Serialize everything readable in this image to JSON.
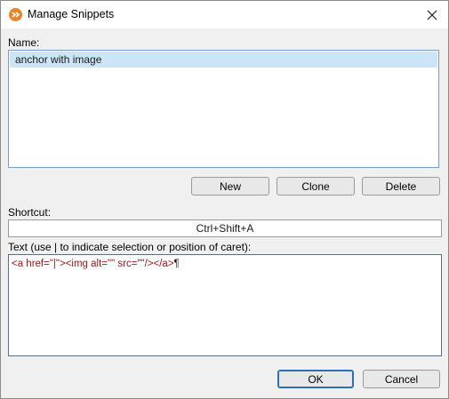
{
  "window": {
    "title": "Manage Snippets",
    "icon": "app-logo-icon",
    "close_icon": "close-icon"
  },
  "name_section": {
    "label": "Name:",
    "items": [
      {
        "label": "anchor with image",
        "selected": true
      }
    ]
  },
  "list_buttons": {
    "new_label": "New",
    "clone_label": "Clone",
    "delete_label": "Delete"
  },
  "shortcut_section": {
    "label": "Shortcut:",
    "value": "Ctrl+Shift+A"
  },
  "text_section": {
    "label": "Text (use | to indicate selection or position of caret):",
    "snippet_text": "<a href=\"|\"><img alt=\"\" src=\"\"/></a>",
    "end_of_line_mark": "¶"
  },
  "footer": {
    "ok_label": "OK",
    "cancel_label": "Cancel"
  },
  "colors": {
    "tag_color": "#a31515",
    "selection": "#cce4f7",
    "accent": "#2f6fb7"
  }
}
